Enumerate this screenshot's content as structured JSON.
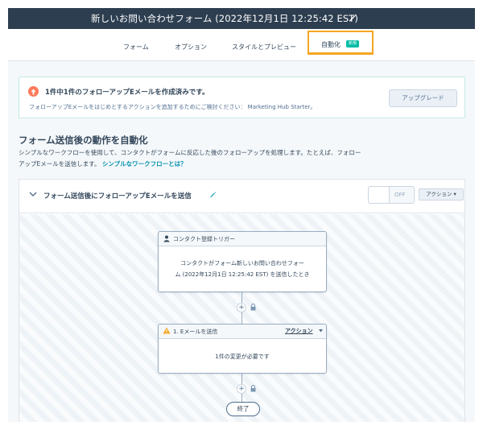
{
  "header": {
    "title": "新しいお問い合わせフォーム (2022年12月1日 12:25:42 EST)",
    "edit_icon": "pencil-icon"
  },
  "tabs": [
    {
      "label": "フォーム"
    },
    {
      "label": "オプション"
    },
    {
      "label": "スタイルとプレビュー"
    },
    {
      "label": "自動化",
      "badge": "新規"
    }
  ],
  "notice": {
    "icon": "arrow-up-circle-icon",
    "title": "1件中1件のフォローアップEメールを作成済みです。",
    "text": "フォローアップEメールをはじめとするアクションを追加するためにご検討ください： Marketing Hub Starter。",
    "button": "アップグレード"
  },
  "section": {
    "title": "フォーム送信後の動作を自動化",
    "desc_line1": "シンプルなワークフローを使用して、コンタクトがフォームに反応した後のフォローアップを処理します。たとえば、フォロー",
    "desc_line2": "アップEメールを送信します。",
    "link": "シンプルなワークフローとは？"
  },
  "workflow": {
    "title": "フォーム送信後にフォローアップEメールを送信",
    "toggle": "OFF",
    "action_button": "アクション ▾",
    "trigger": {
      "label": "コンタクト登録トリガー",
      "body_line1": "コンタクトがフォーム新しいお問い合わせフォー",
      "body_line2": "ム (2022年12月1日 12:25:42 EST) を送信したとき"
    },
    "step": {
      "label": "1. Eメールを送信",
      "action": "アクション",
      "body": "1件の変更が必要です"
    },
    "plus": "+",
    "end": "終了"
  },
  "colors": {
    "header_bg": "#2d3e50",
    "active_tab_border": "#f5a623",
    "badge": "#00bda5",
    "link": "#0091ae",
    "notice_icon": "#ff7a59",
    "warning": "#f5a623"
  }
}
